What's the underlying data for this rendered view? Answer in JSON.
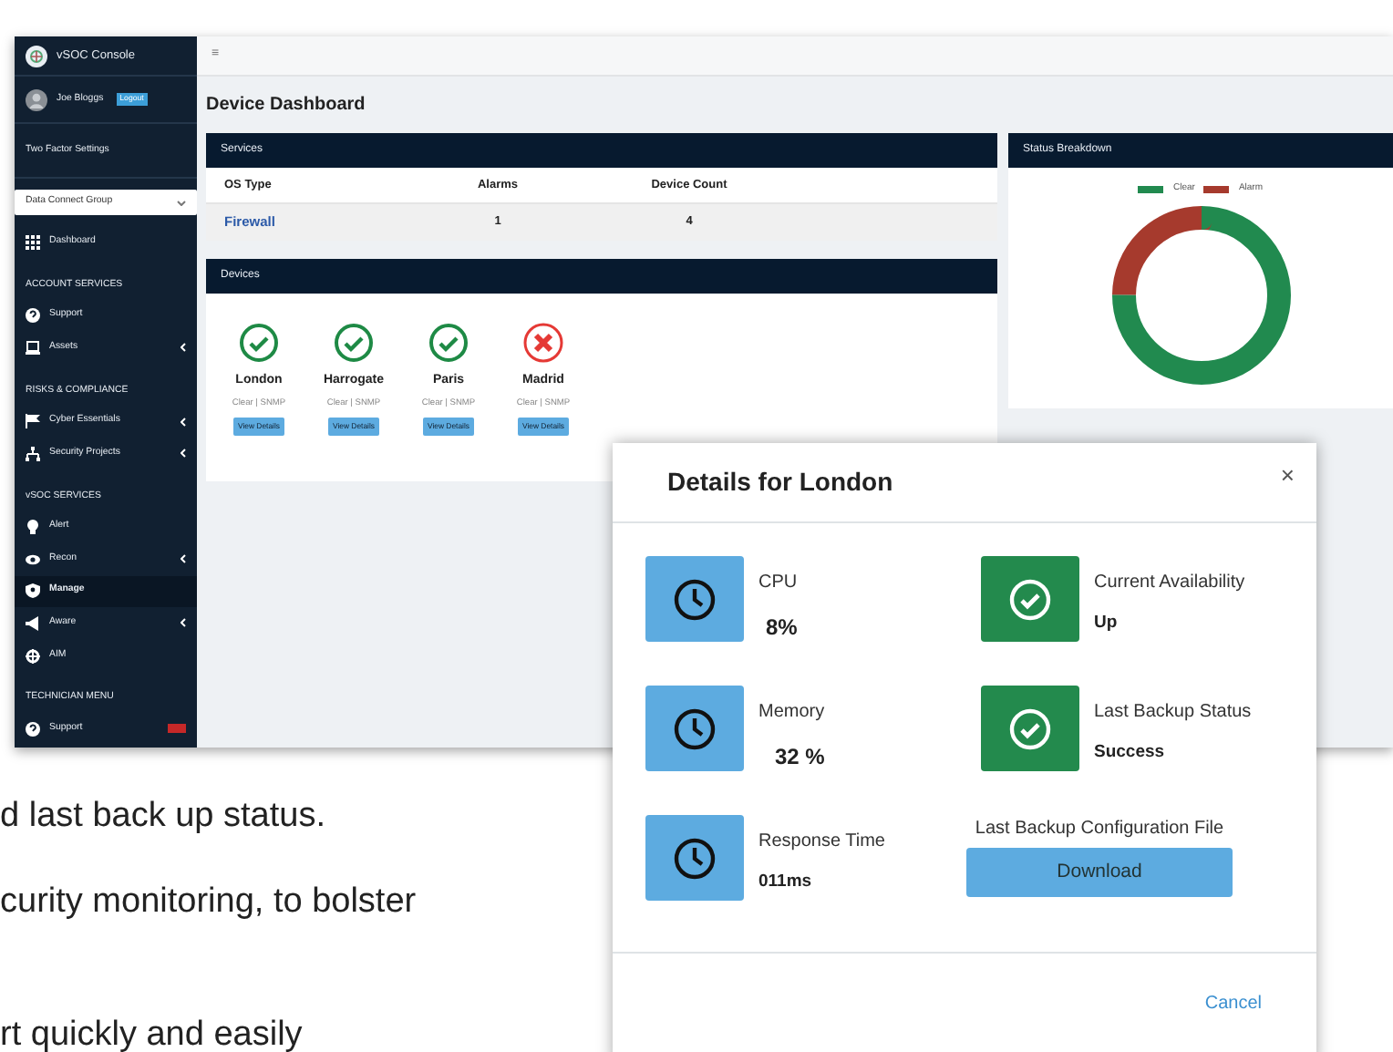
{
  "sidebar": {
    "brand": "vSOC Console",
    "user": "Joe Bloggs",
    "logout": "Logout",
    "two_factor": "Two Factor Settings",
    "group_select": "Data Connect Group",
    "items": [
      {
        "kind": "link",
        "label": "Dashboard",
        "submenu": false,
        "selected": false,
        "badge": false
      },
      {
        "kind": "heading",
        "label": "ACCOUNT SERVICES"
      },
      {
        "kind": "link",
        "label": "Support",
        "submenu": false,
        "selected": false,
        "badge": false
      },
      {
        "kind": "link",
        "label": "Assets",
        "submenu": true,
        "selected": false,
        "badge": false
      },
      {
        "kind": "heading",
        "label": "RISKS & COMPLIANCE"
      },
      {
        "kind": "link",
        "label": "Cyber Essentials",
        "submenu": true,
        "selected": false,
        "badge": false
      },
      {
        "kind": "link",
        "label": "Security Projects",
        "submenu": true,
        "selected": false,
        "badge": false
      },
      {
        "kind": "heading",
        "label": "vSOC SERVICES"
      },
      {
        "kind": "link",
        "label": "Alert",
        "submenu": false,
        "selected": false,
        "badge": false
      },
      {
        "kind": "link",
        "label": "Recon",
        "submenu": true,
        "selected": false,
        "badge": false
      },
      {
        "kind": "link",
        "label": "Manage",
        "submenu": false,
        "selected": true,
        "badge": false
      },
      {
        "kind": "link",
        "label": "Aware",
        "submenu": true,
        "selected": false,
        "badge": false
      },
      {
        "kind": "link",
        "label": "AIM",
        "submenu": false,
        "selected": false,
        "badge": false
      },
      {
        "kind": "heading",
        "label": "TECHNICIAN MENU"
      },
      {
        "kind": "link",
        "label": "Support",
        "submenu": false,
        "selected": false,
        "badge": true
      }
    ]
  },
  "top_bar": {
    "menu_icon": "≡"
  },
  "page_title": "Device Dashboard",
  "services": {
    "title": "Services",
    "columns": [
      "OS Type",
      "Alarms",
      "Device Count"
    ],
    "rows": [
      [
        "Firewall",
        "1",
        "4"
      ]
    ]
  },
  "devices": {
    "title": "Devices",
    "items": [
      {
        "name": "London",
        "alarm": false,
        "status": "Clear | SNMP",
        "button": "View Details"
      },
      {
        "name": "Harrogate",
        "alarm": false,
        "status": "Clear | SNMP",
        "button": "View Details"
      },
      {
        "name": "Paris",
        "alarm": false,
        "status": "Clear | SNMP",
        "button": "View Details"
      },
      {
        "name": "Madrid",
        "alarm": true,
        "status": "Clear | SNMP",
        "button": "View Details"
      }
    ]
  },
  "status_breakdown": {
    "title": "Status Breakdown",
    "chart_data": {
      "type": "donut",
      "categories": [
        "Clear",
        "Alarm"
      ],
      "values": [
        75,
        25
      ],
      "colors": [
        "#218a4f",
        "#a63a2d"
      ],
      "legend": true
    }
  },
  "modal": {
    "title": "Details for London",
    "close": "×",
    "tiles": [
      {
        "kind": "metric",
        "label": "CPU",
        "value": "8%"
      },
      {
        "kind": "status",
        "label": "Current Availability",
        "value": "Up"
      },
      {
        "kind": "metric",
        "label": "Memory",
        "value": "32 %"
      },
      {
        "kind": "status",
        "label": "Last Backup Status",
        "value": "Success"
      },
      {
        "kind": "metric",
        "label": "Response Time",
        "value": "011ms"
      },
      {
        "kind": "download",
        "label": "Last Backup Configuration File",
        "button": "Download"
      }
    ],
    "cancel": "Cancel"
  },
  "page_text": [
    "d last back up status.",
    "curity monitoring, to bolster",
    "rt quickly and easily"
  ]
}
